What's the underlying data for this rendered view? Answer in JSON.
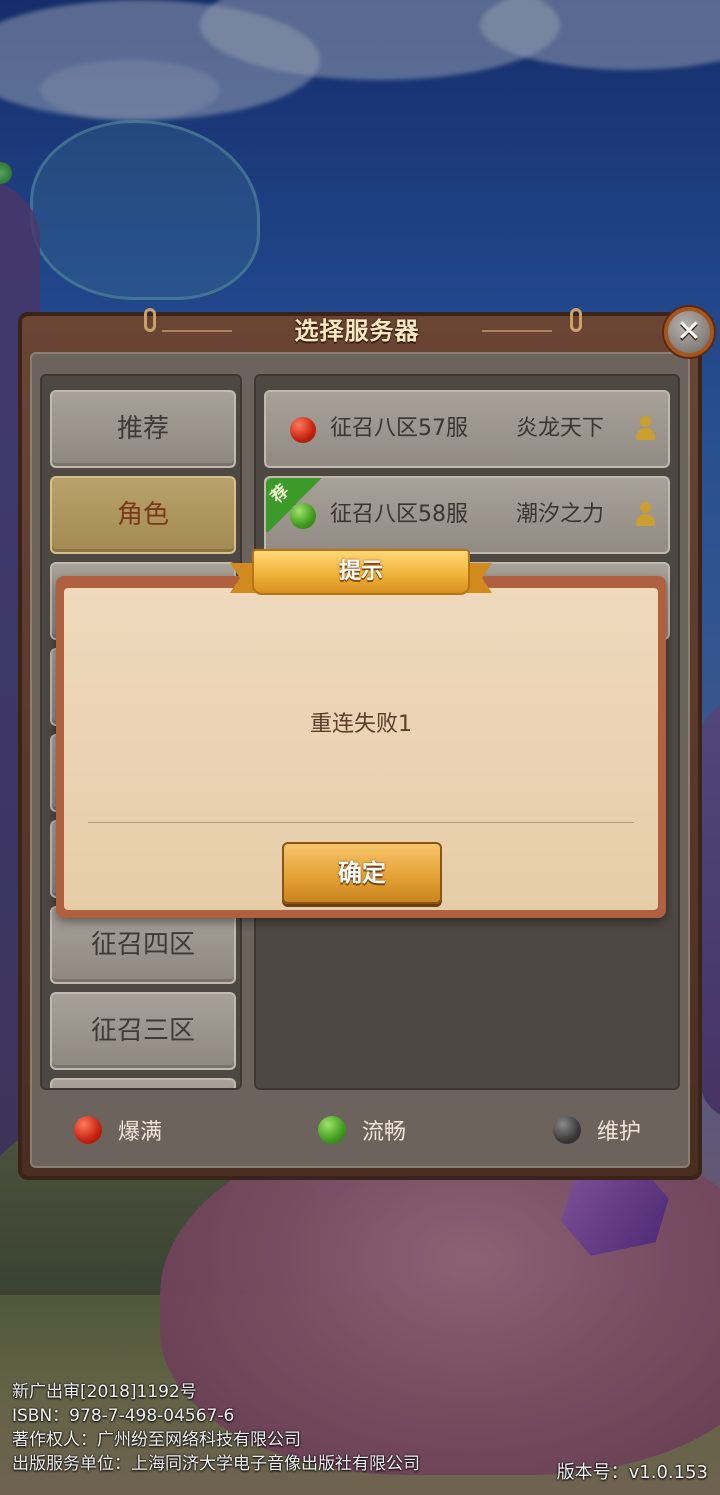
{
  "panel": {
    "title": "选择服务器",
    "close_symbol": "✕"
  },
  "sidebar": {
    "items": [
      {
        "label": "推荐",
        "active": false
      },
      {
        "label": "角色",
        "active": true
      },
      {
        "label": "征召四区",
        "active": false
      },
      {
        "label": "征召三区",
        "active": false
      }
    ]
  },
  "servers": [
    {
      "name": "征召八区57服",
      "role": "炎龙天下",
      "status": "red",
      "recommended": false
    },
    {
      "name": "征召八区58服",
      "role": "潮汐之力",
      "status": "green",
      "recommended": true,
      "tag": "荐"
    }
  ],
  "legend": [
    {
      "label": "爆满",
      "color": "red"
    },
    {
      "label": "流畅",
      "color": "green"
    },
    {
      "label": "维护",
      "color": "gray"
    }
  ],
  "dialog": {
    "title": "提示",
    "message": "重连失败1",
    "ok_label": "确定"
  },
  "footer": {
    "line1": "新广出审[2018]1192号",
    "line2": "ISBN：978-7-498-04567-6",
    "line3": "著作权人：广州纷至网络科技有限公司",
    "line4": "出版服务单位：上海同济大学电子音像出版社有限公司",
    "version": "版本号：v1.0.153"
  },
  "colors": {
    "status_full": "#c4220e",
    "status_smooth": "#3f9a1e",
    "status_maintenance": "#3a3a3a",
    "dialog_border": "#b0603e",
    "ribbon": "#f0b43a"
  }
}
